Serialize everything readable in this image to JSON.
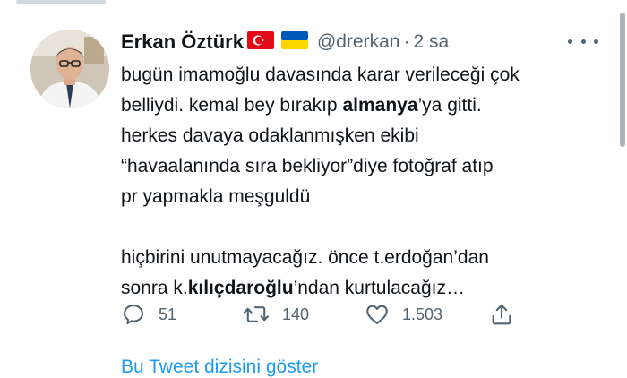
{
  "tweet": {
    "author_name": "Erkan Öztürk",
    "handle": "@drerkan",
    "separator": "·",
    "time": "2 sa",
    "flags": [
      "turkey-flag-icon",
      "ukraine-flag-icon"
    ],
    "text": {
      "l1": "bugün imamoğlu davasında karar verileceği çok",
      "l2_a": "belliydi. kemal bey bırakıp ",
      "l2_bold": "almanya",
      "l2_b": "’ya gitti.",
      "l3": "herkes davaya odaklanmışken ekibi",
      "l4": "“havaalanında sıra bekliyor”diye fotoğraf atıp",
      "l5": "pr yapmakla meşguldü",
      "l6": "hiçbirini unutmayacağız. önce t.erdoğan’dan",
      "l7_a": "sonra k.",
      "l7_bold": "kılıçdaroğlu",
      "l7_b": "’ndan kurtulacağız…"
    },
    "stats": {
      "replies": "51",
      "retweets": "140",
      "likes": "1.503"
    },
    "show_thread": "Bu Tweet dizisini göster"
  },
  "colors": {
    "text": "#0f1419",
    "secondary": "#536471",
    "link": "#1d9bf0"
  }
}
